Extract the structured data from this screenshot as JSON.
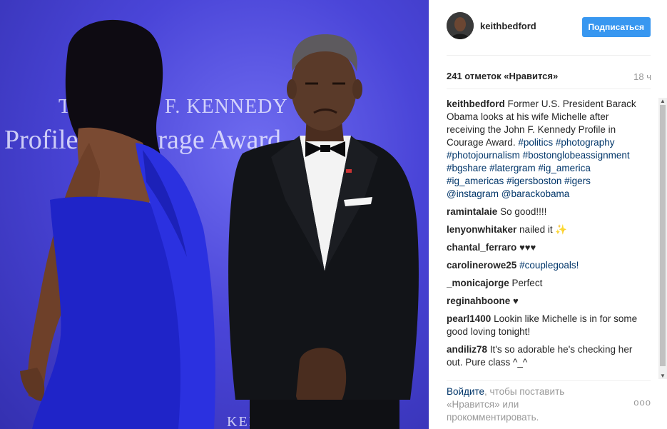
{
  "photo": {
    "backdrop_line1": "THE JOHN F. KENNEDY",
    "backdrop_line2": "Profile in Courage Award",
    "backdrop_fragment": "ro",
    "backdrop_bottom": "KENNEDY"
  },
  "post": {
    "username": "keithbedford",
    "follow_label": "Подписаться",
    "likes": "241 отметок «Нравится»",
    "time": "18 ч",
    "caption_user": "keithbedford",
    "caption_text": "Former U.S. President Barack Obama looks at his wife Michelle after receiving the John F. Kennedy Profile in Courage Award.",
    "hashtags": [
      "#politics",
      "#photography",
      "#photojournalism",
      "#bostonglobeassignment",
      "#bgshare",
      "#latergram",
      "#ig_america",
      "#ig_americas",
      "#igersboston",
      "#igers",
      "@instagram",
      "@barackobama"
    ]
  },
  "comments": [
    {
      "user": "ramintalaie",
      "text": "So good!!!!"
    },
    {
      "user": "lenyonwhitaker",
      "text": "nailed it ✨"
    },
    {
      "user": "chantal_ferraro",
      "text": "♥♥♥"
    },
    {
      "user": "carolinerowe25",
      "text": "#couplegoals!"
    },
    {
      "user": "_monicajorge",
      "text": "Perfect"
    },
    {
      "user": "reginahboone",
      "text": "♥"
    },
    {
      "user": "pearl1400",
      "text": "Lookin like Michelle is in for some good loving tonight!"
    },
    {
      "user": "andiliz78",
      "text": "It's so adorable he's checking her out. Pure class ^_^"
    }
  ],
  "footer": {
    "login_link": "Войдите",
    "login_text": ", чтобы поставить «Нравится» или прокомментировать.",
    "more_icon": "ooo"
  },
  "colors": {
    "accent": "#3897f0",
    "link": "#003569",
    "muted": "#999999",
    "backdrop": "#4a45d8",
    "dress": "#1f24c8"
  },
  "icons": {
    "more": "more-options-icon",
    "scroll_up": "scroll-up-arrow-icon",
    "scroll_down": "scroll-down-arrow-icon"
  }
}
